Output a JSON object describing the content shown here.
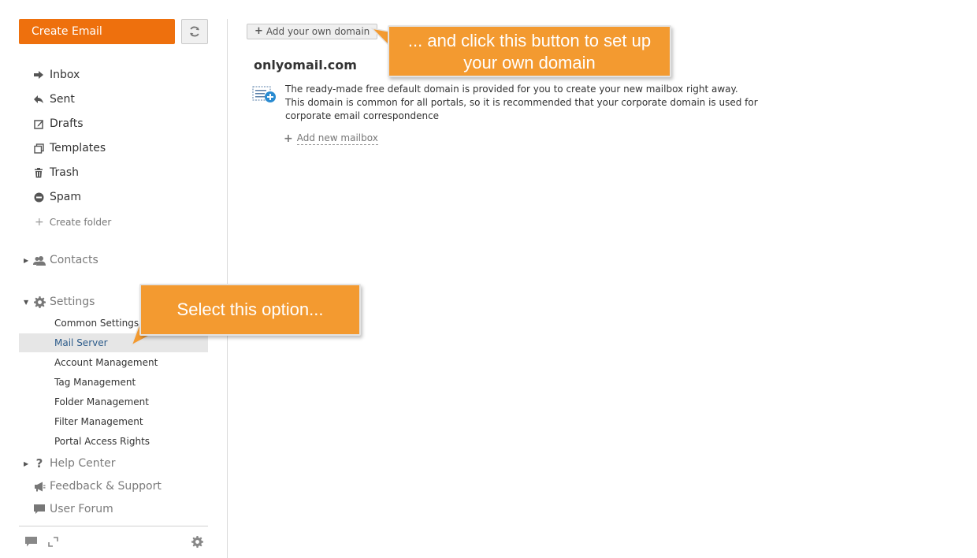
{
  "sidebar": {
    "create_email": "Create Email",
    "folders": [
      {
        "label": "Inbox",
        "icon": "inbox-arrow-icon"
      },
      {
        "label": "Sent",
        "icon": "sent-reply-icon"
      },
      {
        "label": "Drafts",
        "icon": "drafts-edit-icon"
      },
      {
        "label": "Templates",
        "icon": "templates-icon"
      },
      {
        "label": "Trash",
        "icon": "trash-icon"
      },
      {
        "label": "Spam",
        "icon": "spam-icon"
      }
    ],
    "create_folder": "Create folder",
    "contacts": "Contacts",
    "settings": "Settings",
    "settings_items": [
      "Common Settings",
      "Mail Server",
      "Account Management",
      "Tag Management",
      "Folder Management",
      "Filter Management",
      "Portal Access Rights"
    ],
    "active_settings_item": "Mail Server",
    "help_center": "Help Center",
    "feedback": "Feedback & Support",
    "user_forum": "User Forum"
  },
  "main": {
    "add_domain_button": "Add your own domain",
    "domain_name": "onlyomail.com",
    "description_line1": "The ready-made free default domain is provided for you to create your new mailbox right away.",
    "description_line2": "This domain is common for all portals, so it is recommended that your corporate domain is used for corporate email correspondence",
    "add_mailbox": "Add new mailbox"
  },
  "callouts": {
    "domain_hint": "... and click this button to set up your own domain",
    "select_hint": "Select this option..."
  },
  "colors": {
    "accent_orange": "#ee700d",
    "callout_orange": "#f39a30",
    "active_link": "#2c5b8a"
  }
}
